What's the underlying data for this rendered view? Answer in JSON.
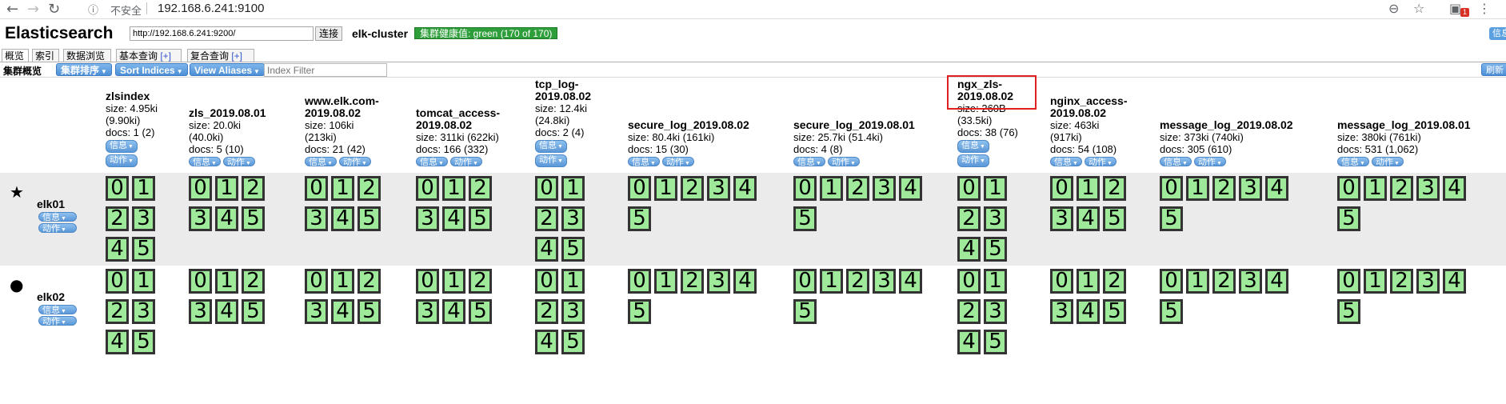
{
  "browser": {
    "security": "不安全",
    "url": "192.168.6.241:9100",
    "extension_badge": "1"
  },
  "app": {
    "title": "Elasticsearch",
    "connect_url": "http://192.168.6.241:9200/",
    "connect_label": "连接",
    "cluster_name": "elk-cluster",
    "cluster_health": "集群健康值: green (170 of 170)",
    "info_label": "信息"
  },
  "tabs": [
    {
      "label": "概览"
    },
    {
      "label": "索引"
    },
    {
      "label": "数据浏览"
    },
    {
      "label": "基本查询 ",
      "plus": "[+]"
    },
    {
      "label": "复合查询 ",
      "plus": "[+]"
    }
  ],
  "toolbar": {
    "label": "集群概览",
    "sort_cluster": "集群排序",
    "sort_indices": "Sort Indices",
    "view_aliases": "View Aliases",
    "index_filter_placeholder": "Index Filter",
    "refresh": "刷新"
  },
  "index_buttons": {
    "info": "信息",
    "action": "动作"
  },
  "indices": [
    {
      "name_lines": [
        "zlsindex"
      ],
      "size": "size: 4.95ki",
      "size2": "(9.90ki)",
      "docs": "docs: 1 (2)",
      "stack": true,
      "shard_count": 6
    },
    {
      "name_lines": [
        "zls_2019.08.01"
      ],
      "size": "size: 20.0ki",
      "size2": "(40.0ki)",
      "docs": "docs: 5 (10)",
      "stack": false,
      "shard_count": 6
    },
    {
      "name_lines": [
        "www.elk.com-",
        "2019.08.02"
      ],
      "size": "size: 106ki",
      "size2": "(213ki)",
      "docs": "docs: 21 (42)",
      "stack": false,
      "shard_count": 6
    },
    {
      "name_lines": [
        "tomcat_access-",
        "2019.08.02"
      ],
      "size": "size: 311ki (622ki)",
      "size2": "",
      "docs": "docs: 166 (332)",
      "stack": false,
      "shard_count": 6
    },
    {
      "name_lines": [
        "tcp_log-",
        "2019.08.02"
      ],
      "size": "size: 12.4ki",
      "size2": "(24.8ki)",
      "docs": "docs: 2 (4)",
      "stack": true,
      "shard_count": 6
    },
    {
      "name_lines": [
        "secure_log_2019.08.02"
      ],
      "size": "size: 80.4ki (161ki)",
      "size2": "",
      "docs": "docs: 15 (30)",
      "stack": false,
      "shard_count": 6
    },
    {
      "name_lines": [
        "secure_log_2019.08.01"
      ],
      "size": "size: 25.7ki (51.4ki)",
      "size2": "",
      "docs": "docs: 4 (8)",
      "stack": false,
      "shard_count": 6
    },
    {
      "name_lines": [
        "ngx_zls-",
        "2019.08.02"
      ],
      "size": "size: 260B",
      "size2": "(33.5ki)",
      "docs": "docs: 38 (76)",
      "stack": true,
      "shard_count": 6
    },
    {
      "name_lines": [
        "nginx_access-",
        "2019.08.02"
      ],
      "size": "size: 463ki",
      "size2": "(917ki)",
      "docs": "docs: 54 (108)",
      "stack": false,
      "shard_count": 6
    },
    {
      "name_lines": [
        "message_log_2019.08.02"
      ],
      "size": "size: 373ki (740ki)",
      "size2": "",
      "docs": "docs: 305 (610)",
      "stack": false,
      "shard_count": 6
    },
    {
      "name_lines": [
        "message_log_2019.08.01"
      ],
      "size": "size: 380ki (761ki)",
      "size2": "",
      "docs": "docs: 531 (1,062)",
      "stack": false,
      "shard_count": 6
    }
  ],
  "nodes": [
    {
      "name": "elk01",
      "marker": "★",
      "info": "信息",
      "action": "动作"
    },
    {
      "name": "elk02",
      "marker": "●",
      "info": "信息",
      "action": "动作"
    }
  ],
  "shard_labels": [
    "0",
    "1",
    "2",
    "3",
    "4",
    "5"
  ]
}
